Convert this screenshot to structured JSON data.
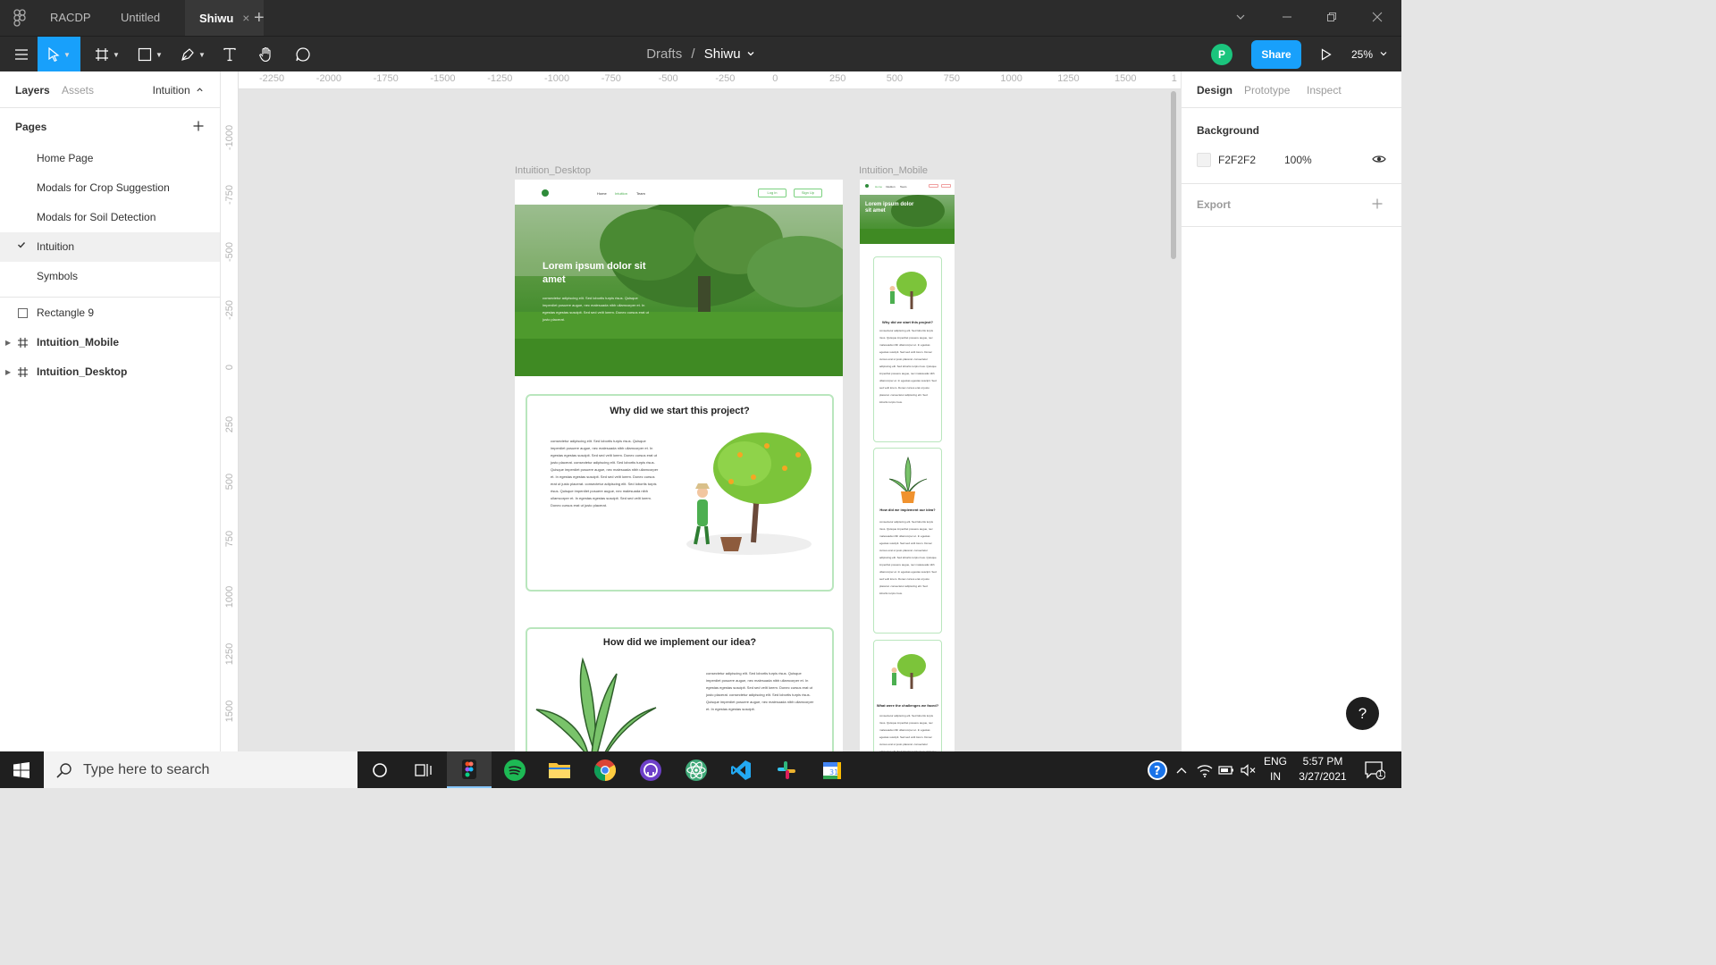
{
  "titlebar": {
    "tabs": [
      {
        "label": "RACDP"
      },
      {
        "label": "Untitled"
      },
      {
        "label": "Shiwu",
        "active": true
      }
    ],
    "close_glyph": "×",
    "new_tab_glyph": "+"
  },
  "toolbar": {
    "breadcrumb_parent": "Drafts",
    "breadcrumb_sep": "/",
    "breadcrumb_file": "Shiwu",
    "avatar_initial": "P",
    "share_label": "Share",
    "zoom": "25%"
  },
  "left_panel": {
    "tab_layers": "Layers",
    "tab_assets": "Assets",
    "current_page": "Intuition",
    "pages_header": "Pages",
    "pages": [
      "Home Page",
      "Modals for Crop Suggestion",
      "Modals for Soil Detection",
      "Intuition",
      "Symbols"
    ],
    "current_page_index": 3,
    "layers": [
      {
        "name": "Rectangle 9",
        "type": "rectangle"
      },
      {
        "name": "Intuition_Mobile",
        "type": "frame"
      },
      {
        "name": "Intuition_Desktop",
        "type": "frame"
      }
    ]
  },
  "canvas": {
    "ruler_top": [
      "-2250",
      "-2000",
      "-1750",
      "-1500",
      "-1250",
      "-1000",
      "-750",
      "-500",
      "-250",
      "0",
      "250",
      "500",
      "750",
      "1000",
      "1250",
      "1500",
      "1"
    ],
    "ruler_left": [
      "-1000",
      "-750",
      "-500",
      "-250",
      "0",
      "250",
      "500",
      "750",
      "1000",
      "1250",
      "1500"
    ],
    "desktop_label": "Intuition_Desktop",
    "mobile_label": "Intuition_Mobile",
    "desktop": {
      "nav": [
        "Home",
        "Intuition",
        "Team"
      ],
      "login": "Log in",
      "signup": "Sign Up",
      "hero_title": "Lorem ipsum dolor sit amet",
      "hero_body": "consectetur adipiscing elit. Sed lobortis turpis risus. Quisque imperdiet posuere augue, nec malesuada nibh ullamcorper et. In egestas egestas suscipit. Sed sed velit lorem. Donec cursus erat ut justo placerat.",
      "card1_title": "Why did we start this project?",
      "card1_body": "consectetur adipiscing elit. Sed lobortis turpis risus. Quisque imperdiet posuere augue, nec malesuada nibh ullamcorper et. In egestas egestas suscipit. Sed sed velit lorem. Donec cursus erat ut justo placerat. consectetur adipiscing elit. Sed lobortis turpis risus. Quisque imperdiet posuere augue, nec malesuada nibh ullamcorper et. In egestas egestas suscipit. Sed sed velit lorem. Donec cursus erat ut justo placerat. consectetur adipiscing elit. Sed lobortis turpis risus. Quisque imperdiet posuere augue, nec malesuada nibh ullamcorper et. In egestas egestas suscipit. Sed sed velit lorem. Donec cursus erat ut justo placerat.",
      "card2_title": "How did we implement our idea?",
      "card2_body": "consectetur adipiscing elit. Sed lobortis turpis risus. Quisque imperdiet posuere augue, nec malesuada nibh ullamcorper et. In egestas egestas suscipit. Sed sed velit lorem. Donec cursus erat ut justo placerat. consectetur adipiscing elit. Sed lobortis turpis risus. Quisque imperdiet posuere augue, nec malesuada nibh ullamcorper et. In egestas egestas suscipit."
    },
    "mobile": {
      "nav": [
        "Home",
        "Intuition",
        "Team"
      ],
      "hero_title": "Lorem ipsum dolor sit amet",
      "card1_title": "Why did we start this project?",
      "card2_title": "How did we implement our idea?",
      "card3_title": "What were the challenges we faced?",
      "card_body": "consectetur adipiscing elit. Sed lobortis turpis risus. Quisque imperdiet posuere augue, nec malesuada nibh ullamcorper et. In egestas egestas suscipit. Sed sed velit lorem. Donec cursus erat ut justo placerat. consectetur adipiscing elit. Sed lobortis turpis risus. Quisque imperdiet posuere augue, nec malesuada nibh ullamcorper et. In egestas egestas suscipit. Sed sed velit lorem. Donec cursus erat ut justo placerat. consectetur adipiscing elit. Sed lobortis turpis risus."
    }
  },
  "right_panel": {
    "tabs": [
      "Design",
      "Prototype",
      "Inspect"
    ],
    "background_header": "Background",
    "background_hex": "F2F2F2",
    "background_opacity": "100%",
    "export_header": "Export",
    "help_glyph": "?"
  },
  "taskbar": {
    "search_placeholder": "Type here to search",
    "lang_line1": "ENG",
    "lang_line2": "IN",
    "time": "5:57 PM",
    "date": "3/27/2021",
    "notification_count": "1"
  },
  "colors": {
    "accent": "#18a0fb",
    "avatar": "#1bc47d",
    "chrome_dark": "#2c2c2c",
    "canvas_bg": "#e5e5e5",
    "leaf_green": "#4caf50"
  }
}
